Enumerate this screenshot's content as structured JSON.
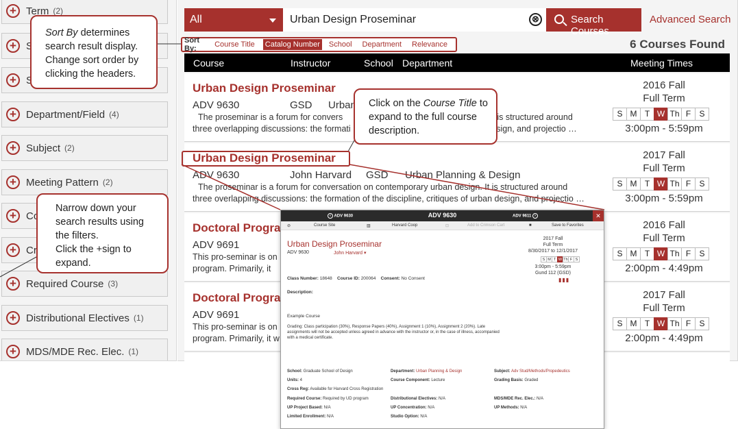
{
  "sidebar": {
    "filters": [
      {
        "label": "Term",
        "count": "(2)"
      },
      {
        "label": "S",
        "count": ""
      },
      {
        "label": "S",
        "count": ""
      },
      {
        "label": "Department/Field",
        "count": "(4)"
      },
      {
        "label": "Subject",
        "count": "(2)"
      },
      {
        "label": "Meeting Pattern",
        "count": "(2)"
      },
      {
        "label": "Cou",
        "count": ""
      },
      {
        "label": "Cro",
        "count": ""
      },
      {
        "label": "Required Course",
        "count": "(3)"
      },
      {
        "label": "Distributional Electives",
        "count": "(1)"
      },
      {
        "label": "MDS/MDE Rec. Elec.",
        "count": "(1)"
      }
    ]
  },
  "search": {
    "scope": "All",
    "query": "Urban Design Proseminar",
    "clear_glyph": "⊗",
    "button_label": "Search Courses",
    "advanced_label": "Advanced Search"
  },
  "sort": {
    "label": "Sort By:",
    "options": [
      "Course Title",
      "Catalog Number",
      "School",
      "Department",
      "Relevance"
    ],
    "active": "Catalog Number"
  },
  "results": {
    "found": "6 Courses Found",
    "columns": {
      "course": "Course",
      "instructor": "Instructor",
      "school": "School",
      "department": "Department",
      "meeting": "Meeting Times"
    },
    "days": [
      "S",
      "M",
      "T",
      "W",
      "Th",
      "F",
      "S"
    ],
    "rows": [
      {
        "title": "Urban Design Proseminar",
        "number": "ADV 9630",
        "instructor": "",
        "school": "GSD",
        "department": "Urban",
        "desc1": "The proseminar is a forum for convers",
        "desc1_right": "n. It is structured around",
        "desc2": "three overlapping discussions: the formati",
        "desc2_right": "an design, and projectio …",
        "term": "2016 Fall",
        "session": "Full Term",
        "active_day": "W",
        "time": "3:00pm - 5:59pm"
      },
      {
        "title": "Urban Design Proseminar",
        "number": "ADV 9630",
        "instructor": "John Harvard",
        "school": "GSD",
        "department": "Urban Planning & Design",
        "desc1": "The proseminar is a forum for conversation on contemporary urban design. It is structured around",
        "desc1_right": "",
        "desc2": "three overlapping discussions: the formation of the discipline, critiques of urban design, and projectio …",
        "desc2_right": "",
        "term": "2017 Fall",
        "session": "Full Term",
        "active_day": "W",
        "time": "3:00pm - 5:59pm"
      },
      {
        "title": "Doctoral Progra",
        "number": "ADV 9691",
        "instructor": "",
        "school": "",
        "department": "",
        "desc1": "This pro-seminar is on",
        "desc1_right": "",
        "desc2": "program. Primarily, it",
        "desc2_right": "",
        "term": "2016 Fall",
        "session": "Full Term",
        "active_day": "W",
        "time": "2:00pm - 4:49pm"
      },
      {
        "title": "Doctoral Progra",
        "number": "ADV 9691",
        "instructor": "",
        "school": "",
        "department": "",
        "desc1": "This pro-seminar is on",
        "desc1_right": "",
        "desc2": "program. Primarily, it w",
        "desc2_right": "",
        "term": "2017 Fall",
        "session": "Full Term",
        "active_day": "W",
        "time": "2:00pm - 4:49pm"
      }
    ]
  },
  "callouts": {
    "sort_em": "Sort By",
    "sort_text": " determines search result display. Change sort order by clicking the headers.",
    "title_pre": "Click on the ",
    "title_em": "Course Title",
    "title_post": " to expand to the full course description.",
    "filter_text": "Narrow down your search results using the filters.",
    "filter_text2": "Click the +sign to expand."
  },
  "popup": {
    "prev": "ADV 9630",
    "current": "ADV 9630",
    "next": "ADV 9611",
    "close": "✕",
    "tools": [
      "Course Site",
      "Harvard Coop",
      "Add to Crimson Cart",
      "Save to Favorites"
    ],
    "title": "Urban Design Proseminar",
    "number": "ADV 9630",
    "instructor": "John Harvard ▾",
    "term": "2017 Fall",
    "session": "Full Term",
    "dates": "8/30/2017 to 12/1/2017",
    "days": [
      "S",
      "M",
      "T",
      "W",
      "Th",
      "F",
      "S"
    ],
    "time": "3:00pm - 5:59pm",
    "location": "Gund 112 (GSD)",
    "class_number_label": "Class Number:",
    "class_number": "18648",
    "course_id_label": "Course ID:",
    "course_id": "200064",
    "consent_label": "Consent:",
    "consent": "No Consent",
    "description_label": "Description:",
    "example": "Example Course",
    "grading1": "Grading: Class participation (30%), Response Papers (40%), Assignment 1 (10%), Assignment 2 (20%). Late",
    "grading2": "assignments will not be accepted unless agreed in advance with the instructor or, in the case of illness, accompanied",
    "grading3": "with a medical certificate.",
    "details": {
      "school_label": "School:",
      "school": "Graduate School of Design",
      "department_label": "Department:",
      "department": "Urban Planning & Design",
      "subject_label": "Subject:",
      "subject": "Adv Stud/Methods/Propedeutics",
      "units_label": "Units:",
      "units": "4",
      "component_label": "Course Component:",
      "component": "Lecture",
      "grading_label": "Grading Basis:",
      "grading": "Graded",
      "crossreg_label": "Cross Reg:",
      "crossreg": "Available for Harvard Cross Registration",
      "required_label": "Required Course:",
      "required": "Required by UD program",
      "distrib_label": "Distributional Electives:",
      "distrib": "N/A",
      "mds_label": "MDS/MDE Rec. Elec.:",
      "mds": "N/A",
      "upproject_label": "UP Project Based:",
      "upproject": "N/A",
      "upconc_label": "UP Concentration:",
      "upconc": "N/A",
      "upmethods_label": "UP Methods:",
      "upmethods": "N/A",
      "limited_label": "Limited Enrollment:",
      "limited": "N/A",
      "studio_label": "Studio Option:",
      "studio": "N/A"
    }
  },
  "colors": {
    "accent": "#a6312d",
    "header": "#000000"
  }
}
